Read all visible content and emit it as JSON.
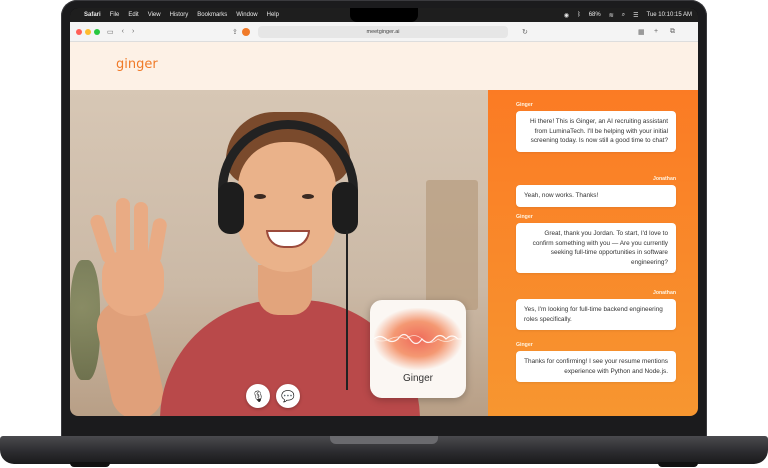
{
  "menubar": {
    "apple": "",
    "app": "Safari",
    "items": [
      "File",
      "Edit",
      "View",
      "History",
      "Bookmarks",
      "Window",
      "Help"
    ],
    "battery": "68%",
    "clock": "Tue 10:10:15 AM"
  },
  "browser": {
    "url": "meetginger.ai"
  },
  "page": {
    "brand": "ginger"
  },
  "video_call": {
    "assistant_card_label": "Ginger"
  },
  "chat": {
    "messages": [
      {
        "sender": "Ginger",
        "text": "Hi there! This is Ginger, an AI recruiting assistant from LuminaTech. I'll be helping with your initial screening today. Is now still a good time to chat?"
      },
      {
        "sender": "Jonathan",
        "text": "Yeah, now works. Thanks!"
      },
      {
        "sender": "Ginger",
        "text": "Great, thank you Jordan. To start, I'd love to confirm something with you — Are you currently seeking full-time opportunities in software engineering?"
      },
      {
        "sender": "Jonathan",
        "text": "Yes, I'm looking for full-time backend engineering roles specifically."
      },
      {
        "sender": "Ginger",
        "text": "Thanks for confirming! I see your resume mentions experience with Python and Node.js."
      }
    ]
  },
  "colors": {
    "accent": "#f07a28",
    "chat_bg": "#fb7b24"
  }
}
